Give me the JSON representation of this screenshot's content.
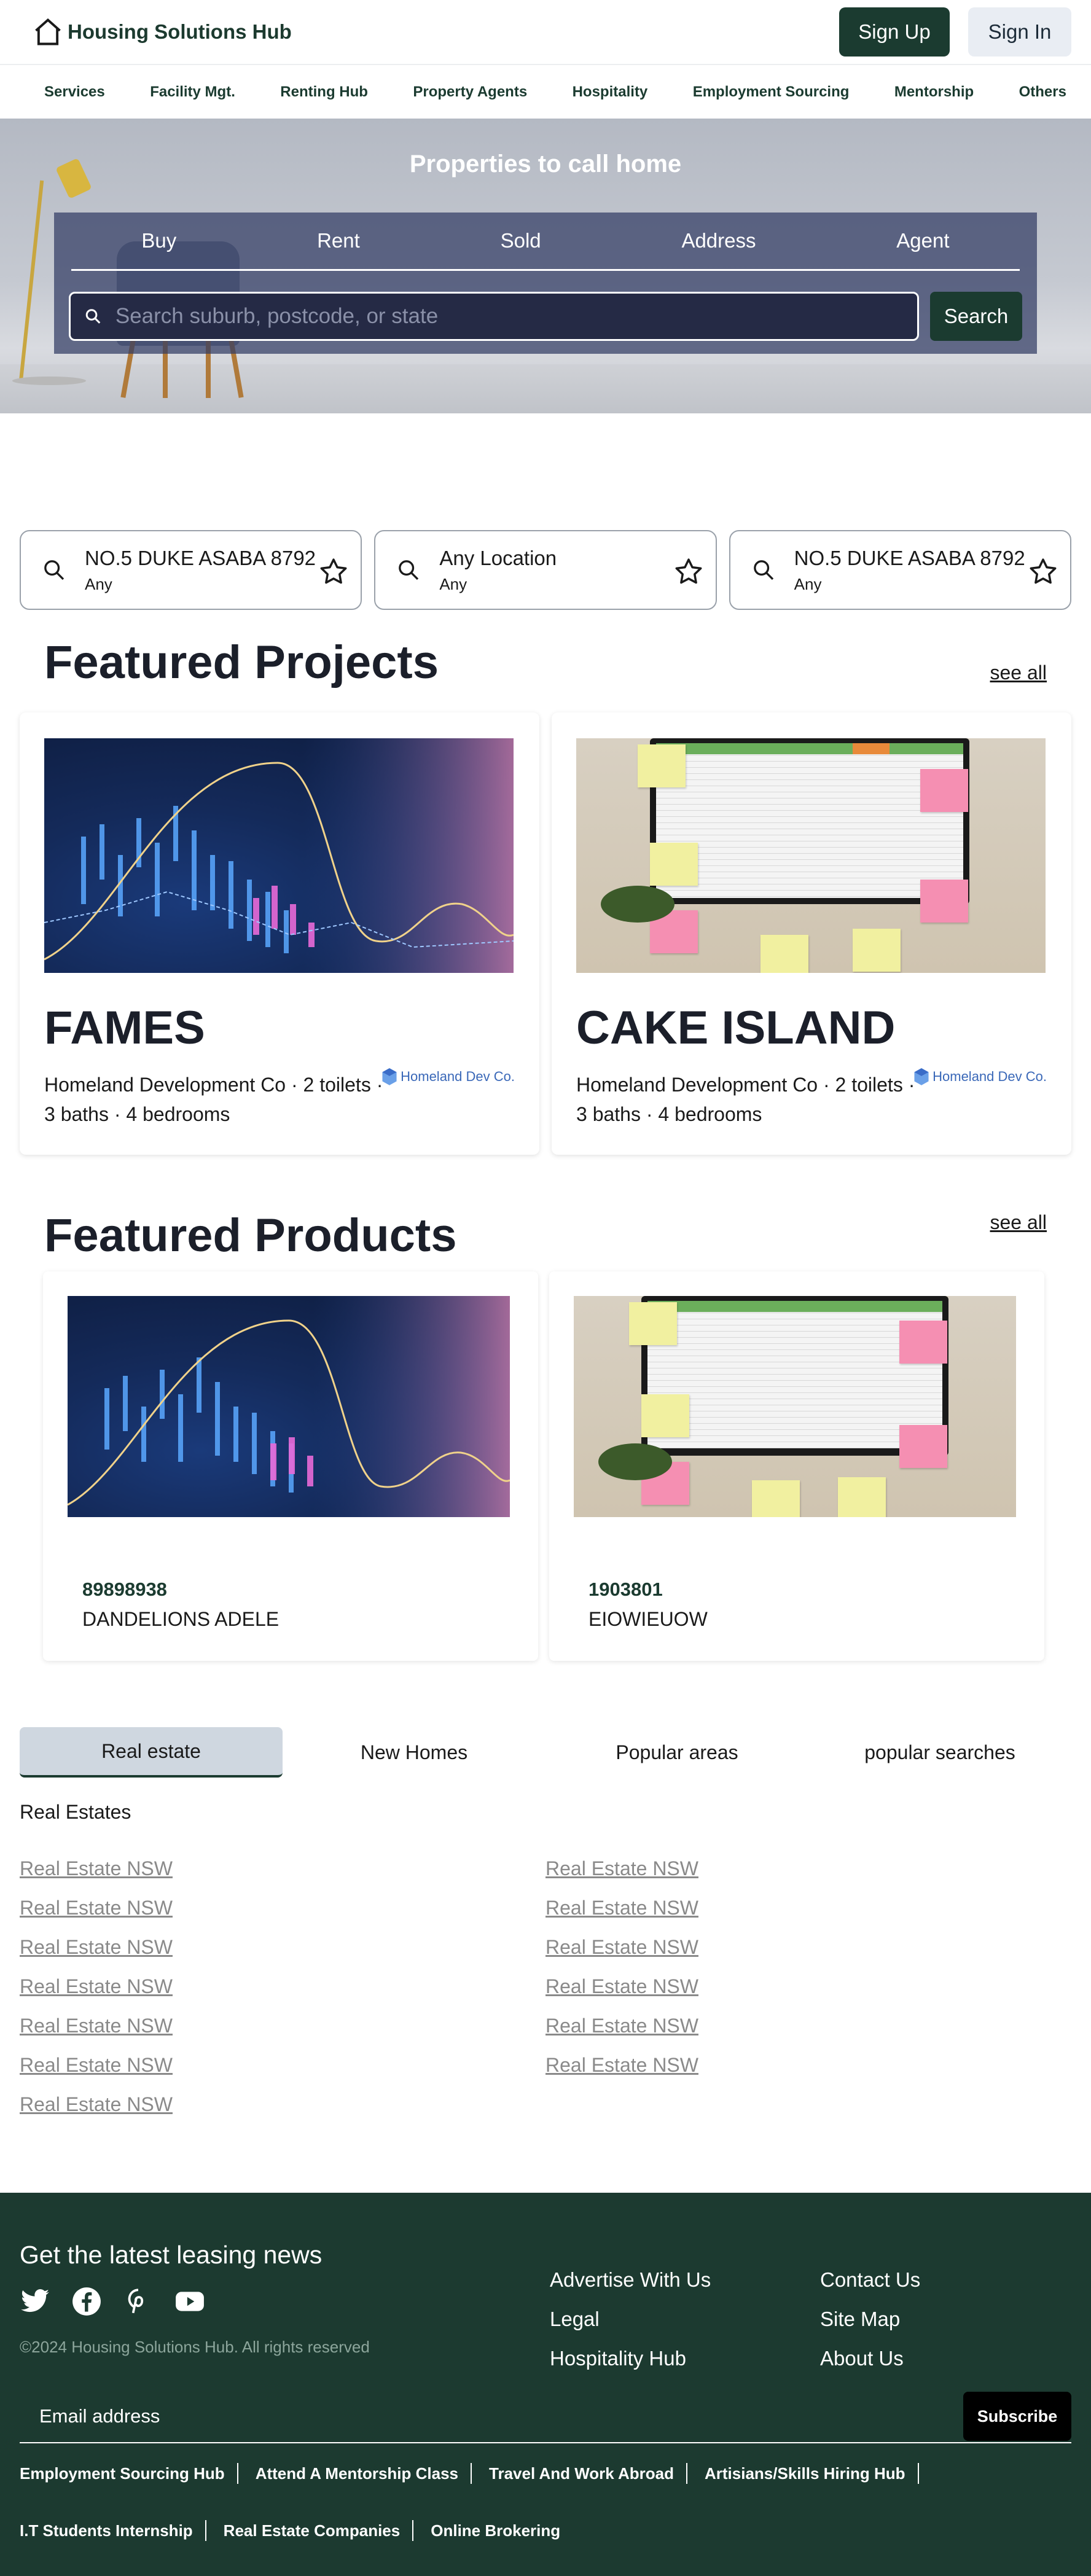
{
  "header": {
    "brand": "Housing Solutions Hub",
    "signup": "Sign Up",
    "signin": "Sign In"
  },
  "nav": [
    "Services",
    "Facility Mgt.",
    "Renting Hub",
    "Property Agents",
    "Hospitality",
    "Employment Sourcing",
    "Mentorship",
    "Others"
  ],
  "hero": {
    "title": "Properties to call home",
    "tabs": [
      "Buy",
      "Rent",
      "Sold",
      "Address",
      "Agent"
    ],
    "search_placeholder": "Search suburb, postcode, or state",
    "search_button": "Search"
  },
  "saved_searches": [
    {
      "title": "NO.5 DUKE ASABA 8792",
      "sub": "Any"
    },
    {
      "title": "Any Location",
      "sub": "Any"
    },
    {
      "title": "NO.5 DUKE ASABA 8792",
      "sub": "Any"
    }
  ],
  "featured_projects": {
    "title": "Featured Projects",
    "see_all": "see all",
    "items": [
      {
        "name": "FAMES",
        "info_line1": "Homeland Development Co · 2 toilets ·",
        "info_line2": "3 baths · 4 bedrooms",
        "logo": "Homeland Dev Co."
      },
      {
        "name": "CAKE ISLAND",
        "info_line1": "Homeland Development Co · 2 toilets ·",
        "info_line2": "3 baths · 4 bedrooms",
        "logo": "Homeland Dev Co."
      }
    ]
  },
  "featured_products": {
    "title": "Featured Products",
    "see_all": "see all",
    "items": [
      {
        "code": "89898938",
        "name": "DANDELIONS ADELE"
      },
      {
        "code": "1903801",
        "name": "EIOWIEUOW"
      }
    ]
  },
  "category_tabs": [
    "Real estate",
    "New Homes",
    "Popular areas",
    "popular searches"
  ],
  "real_estates": {
    "title": "Real Estates",
    "col1": [
      "Real Estate NSW",
      "Real Estate NSW",
      "Real Estate NSW",
      "Real Estate NSW",
      "Real Estate NSW",
      "Real Estate NSW",
      "Real Estate NSW"
    ],
    "col2": [
      "Real Estate NSW",
      "Real Estate NSW",
      "Real Estate NSW",
      "Real Estate NSW",
      "Real Estate NSW",
      "Real Estate NSW"
    ]
  },
  "footer": {
    "news": "Get the latest leasing news",
    "social_icons": [
      "twitter-icon",
      "facebook-icon",
      "pinterest-icon",
      "youtube-icon"
    ],
    "copyright": "©2024 Housing Solutions Hub. All rights reserved",
    "col1": [
      "Advertise With Us",
      "Legal",
      "Hospitality Hub"
    ],
    "col2": [
      "Contact Us",
      "Site Map",
      "About Us"
    ],
    "email_placeholder": "Email address",
    "subscribe": "Subscribe",
    "links_row1": [
      "Employment Sourcing Hub",
      "Attend A Mentorship Class",
      "Travel And Work Abroad",
      "Artisians/Skills Hiring Hub"
    ],
    "links_row2": [
      "I.T Students Internship",
      "Real Estate Companies",
      "Online Brokering"
    ]
  },
  "colors": {
    "brand_green": "#1b3b30",
    "signin_bg": "#e9edf3",
    "tab_active_bg": "#cfd7e0"
  }
}
